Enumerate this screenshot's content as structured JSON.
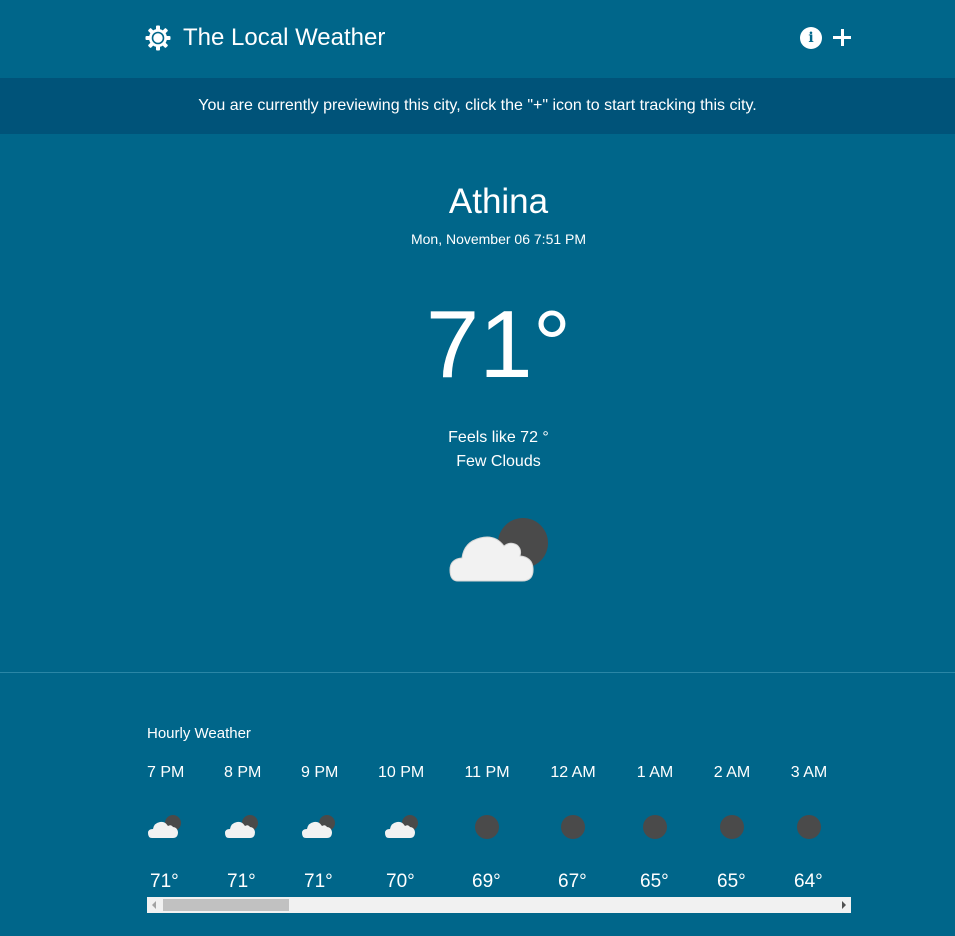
{
  "header": {
    "title": "The Local Weather",
    "logo_icon": "sun-gear-icon",
    "info_icon": "info-icon",
    "add_icon": "plus-icon"
  },
  "banner": {
    "text": "You are currently previewing this city, click the \"+\" icon to start tracking this city."
  },
  "current": {
    "city": "Athina",
    "datetime": "Mon, November 06 7:51 PM",
    "temperature": "71°",
    "feels_like": "Feels like 72 °",
    "condition": "Few Clouds",
    "icon": "cloud-moon-icon"
  },
  "hourly": {
    "title": "Hourly Weather",
    "items": [
      {
        "time": "7 PM",
        "temp": "71°",
        "icon": "cloud-moon-icon"
      },
      {
        "time": "8 PM",
        "temp": "71°",
        "icon": "cloud-moon-icon"
      },
      {
        "time": "9 PM",
        "temp": "71°",
        "icon": "cloud-moon-icon"
      },
      {
        "time": "10 PM",
        "temp": "70°",
        "icon": "cloud-moon-icon"
      },
      {
        "time": "11 PM",
        "temp": "69°",
        "icon": "moon-icon"
      },
      {
        "time": "12 AM",
        "temp": "67°",
        "icon": "moon-icon"
      },
      {
        "time": "1 AM",
        "temp": "65°",
        "icon": "moon-icon"
      },
      {
        "time": "2 AM",
        "temp": "65°",
        "icon": "moon-icon"
      },
      {
        "time": "3 AM",
        "temp": "64°",
        "icon": "moon-icon"
      }
    ]
  },
  "colors": {
    "background": "#00668a",
    "banner": "#005379",
    "moon": "#4a4a4a",
    "cloud": "#f2f2f2"
  }
}
